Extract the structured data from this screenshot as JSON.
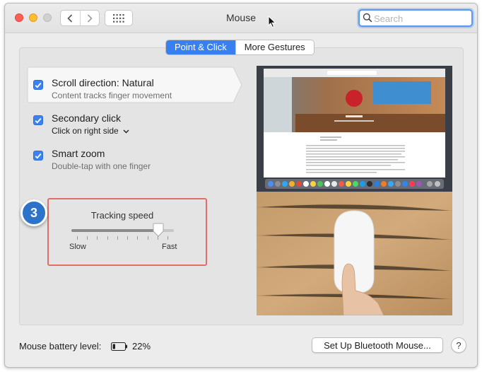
{
  "window": {
    "title": "Mouse"
  },
  "search": {
    "placeholder": "Search",
    "value": ""
  },
  "tabs": [
    {
      "label": "Point & Click",
      "active": true
    },
    {
      "label": "More Gestures",
      "active": false
    }
  ],
  "options": [
    {
      "title": "Scroll direction: Natural",
      "subtitle": "Content tracks finger movement",
      "checked": true,
      "selected": true
    },
    {
      "title": "Secondary click",
      "subtitle": "Click on right side",
      "checked": true,
      "has_dropdown": true
    },
    {
      "title": "Smart zoom",
      "subtitle": "Double-tap with one finger",
      "checked": true
    }
  ],
  "step_badge": "3",
  "tracking": {
    "label": "Tracking speed",
    "min_label": "Slow",
    "max_label": "Fast",
    "value_fraction": 0.85,
    "tick_count": 10
  },
  "footer": {
    "battery_label": "Mouse battery level:",
    "battery_percent": "22%",
    "battery_fraction": 0.22,
    "setup_button": "Set Up Bluetooth Mouse...",
    "help_button": "?"
  },
  "colors": {
    "accent": "#3880f0",
    "highlight_border": "#e06f6a",
    "badge": "#2d73c9"
  }
}
